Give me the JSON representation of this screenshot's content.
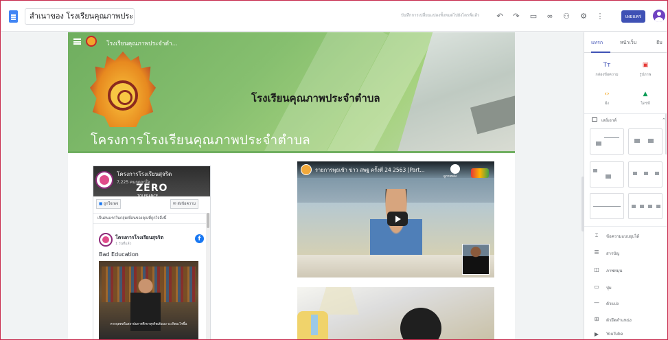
{
  "topbar": {
    "doc_title": "สำเนาของ โรงเรียนคุณภาพประ...",
    "saved_note": "บันทึกการเปลี่ยนแปลงทั้งหมดไปยังไดรฟ์แล้ว",
    "publish_label": "เผยแพร่",
    "icons": [
      "undo-icon",
      "redo-icon",
      "preview-icon",
      "link-icon",
      "add-person-icon",
      "settings-icon",
      "more-icon"
    ]
  },
  "site": {
    "nav_title": "โรงเรียนคุณภาพประจำตำ...",
    "banner_title": "โรงเรียนคุณภาพประจำตำบล",
    "banner_subtitle": "โครงการโรงเรียนคุณภาพประจำตำบล"
  },
  "facebook": {
    "page_name": "โครงการโรงเรียนสุจริต",
    "likes": "7,225 คนกดถูกใจ",
    "logo_word": "ZERO",
    "logo_sub": "TOLERANCE",
    "like_btn": "ถูกใจเพจ",
    "message_btn": "ส่งข้อความ",
    "notice": "เป็นคนแรกในกลุ่มเพื่อนของคุณที่ถูกใจสิ่งนี้",
    "post_name": "โครงการโรงเรียนสุจริต",
    "post_time": "1 วันที่แล้ว",
    "post_text": "Bad Education",
    "image_caption": "หากบุคคลในสถาบันการศึกษาทุจริตเสียเอง จะเกิดอะไรขึ้น"
  },
  "youtube": {
    "video1_title": "รายการพุธเช้า ข่าว สพฐ ครั้งที่ 24 2563 [Part...",
    "watch_later": "ดูภายหลัง"
  },
  "panel": {
    "tabs": [
      "แทรก",
      "หน้าเว็บ",
      "ธีม"
    ],
    "tiles": [
      {
        "icon": "text-box-icon",
        "glyph": "Tт",
        "label": "กล่องข้อความ"
      },
      {
        "icon": "image-icon",
        "glyph": "▣",
        "label": "รูปภาพ"
      },
      {
        "icon": "embed-icon",
        "glyph": "‹›",
        "label": "ฝัง"
      },
      {
        "icon": "drive-icon",
        "glyph": "▲",
        "label": "ไดรฟ์"
      }
    ],
    "layouts_label": "เลย์เอาต์",
    "content_items": [
      {
        "icon": "collapsible-text-icon",
        "glyph": "⌶",
        "label": "ข้อความแบบยุบได้"
      },
      {
        "icon": "toc-icon",
        "glyph": "☰",
        "label": "สารบัญ"
      },
      {
        "icon": "carousel-icon",
        "glyph": "◫",
        "label": "ภาพหมุน"
      },
      {
        "icon": "button-icon",
        "glyph": "▭",
        "label": "ปุ่ม"
      },
      {
        "icon": "divider-icon",
        "glyph": "—",
        "label": "ตัวแบ่ง"
      },
      {
        "icon": "placeholder-icon",
        "glyph": "⊞",
        "label": "ตัวยึดตำแหน่ง"
      },
      {
        "icon": "youtube-icon",
        "glyph": "▶",
        "label": "YouTube"
      }
    ]
  },
  "colors": {
    "accent": "#3f51b5",
    "banner_green": "#6fae5f",
    "frame_border": "#c6284a"
  }
}
